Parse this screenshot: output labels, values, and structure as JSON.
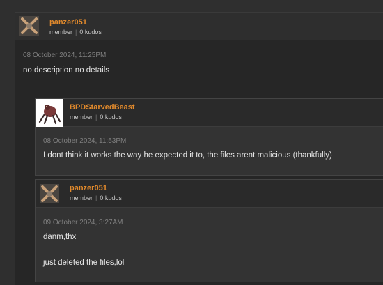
{
  "comments": [
    {
      "author": "panzer051",
      "role": "member",
      "kudos": "0 kudos",
      "date": "08 October 2024, 11:25PM",
      "body": [
        "no description no details"
      ],
      "avatar_icon": "gear-cross-icon"
    }
  ],
  "replies": [
    {
      "author": "BPDStarvedBeast",
      "role": "member",
      "kudos": "0 kudos",
      "date": "08 October 2024, 11:53PM",
      "body": [
        "I dont think it works the way he expected it to, the files arent malicious (thankfully)"
      ],
      "avatar_icon": "creature-avatar-icon"
    },
    {
      "author": "panzer051",
      "role": "member",
      "kudos": "0 kudos",
      "date": "09 October 2024, 3:27AM",
      "body": [
        "danm,thx",
        "just deleted the files,lol"
      ],
      "avatar_icon": "gear-cross-icon"
    }
  ],
  "colors": {
    "author": "#e28a2c",
    "background": "#2f2f2f",
    "panel": "#262626",
    "reply_panel": "#333333"
  }
}
